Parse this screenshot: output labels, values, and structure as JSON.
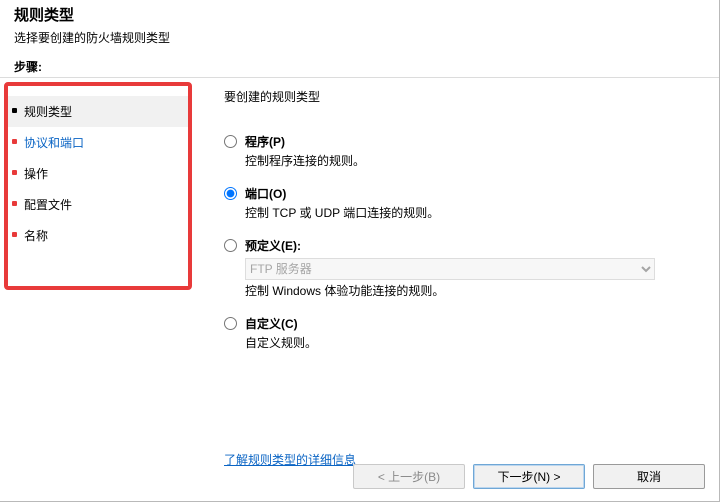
{
  "header": {
    "title": "规则类型",
    "subtitle": "选择要创建的防火墙规则类型",
    "steps_label": "步骤:"
  },
  "sidebar": {
    "items": [
      {
        "label": "规则类型"
      },
      {
        "label": "协议和端口"
      },
      {
        "label": "操作"
      },
      {
        "label": "配置文件"
      },
      {
        "label": "名称"
      }
    ]
  },
  "main": {
    "lead": "要创建的规则类型",
    "options": [
      {
        "title": "程序(P)",
        "desc": "控制程序连接的规则。"
      },
      {
        "title": "端口(O)",
        "desc": "控制 TCP 或 UDP 端口连接的规则。"
      },
      {
        "title": "预定义(E):",
        "desc": "控制 Windows 体验功能连接的规则。",
        "combo": "FTP 服务器"
      },
      {
        "title": "自定义(C)",
        "desc": "自定义规则。"
      }
    ],
    "learn_more": "了解规则类型的详细信息"
  },
  "footer": {
    "back": "< 上一步(B)",
    "next": "下一步(N) >",
    "cancel": "取消"
  }
}
